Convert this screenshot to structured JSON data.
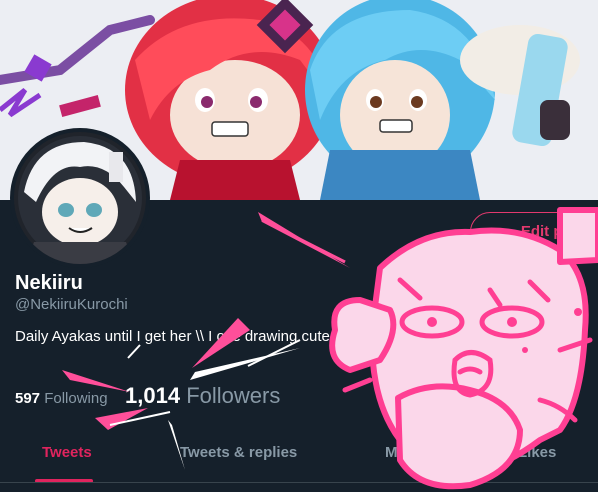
{
  "profile": {
    "display_name": "Nekiiru",
    "handle": "@NekiiruKurochi",
    "bio": "Daily Ayakas until I get her \\\\ I ove drawing cute"
  },
  "stats": {
    "following_count": "597",
    "following_label": "Following",
    "followers_count": "1,014",
    "followers_label": "Followers"
  },
  "tabs": [
    {
      "label": "Tweets",
      "active": true
    },
    {
      "label": "Tweets & replies",
      "active": false
    },
    {
      "label": "Media",
      "active": false
    },
    {
      "label": "Likes",
      "active": false
    }
  ],
  "button": {
    "label": "Edit profile"
  },
  "colors": {
    "background": "#15202b",
    "accent": "#e0245e",
    "doodle_pink": "#ff4f9a",
    "muted_text": "#8899a6"
  },
  "icons": {
    "banner": "anime-art-banner",
    "avatar": "avatar-chibi",
    "overlay": "pink-doodle-overlay"
  }
}
